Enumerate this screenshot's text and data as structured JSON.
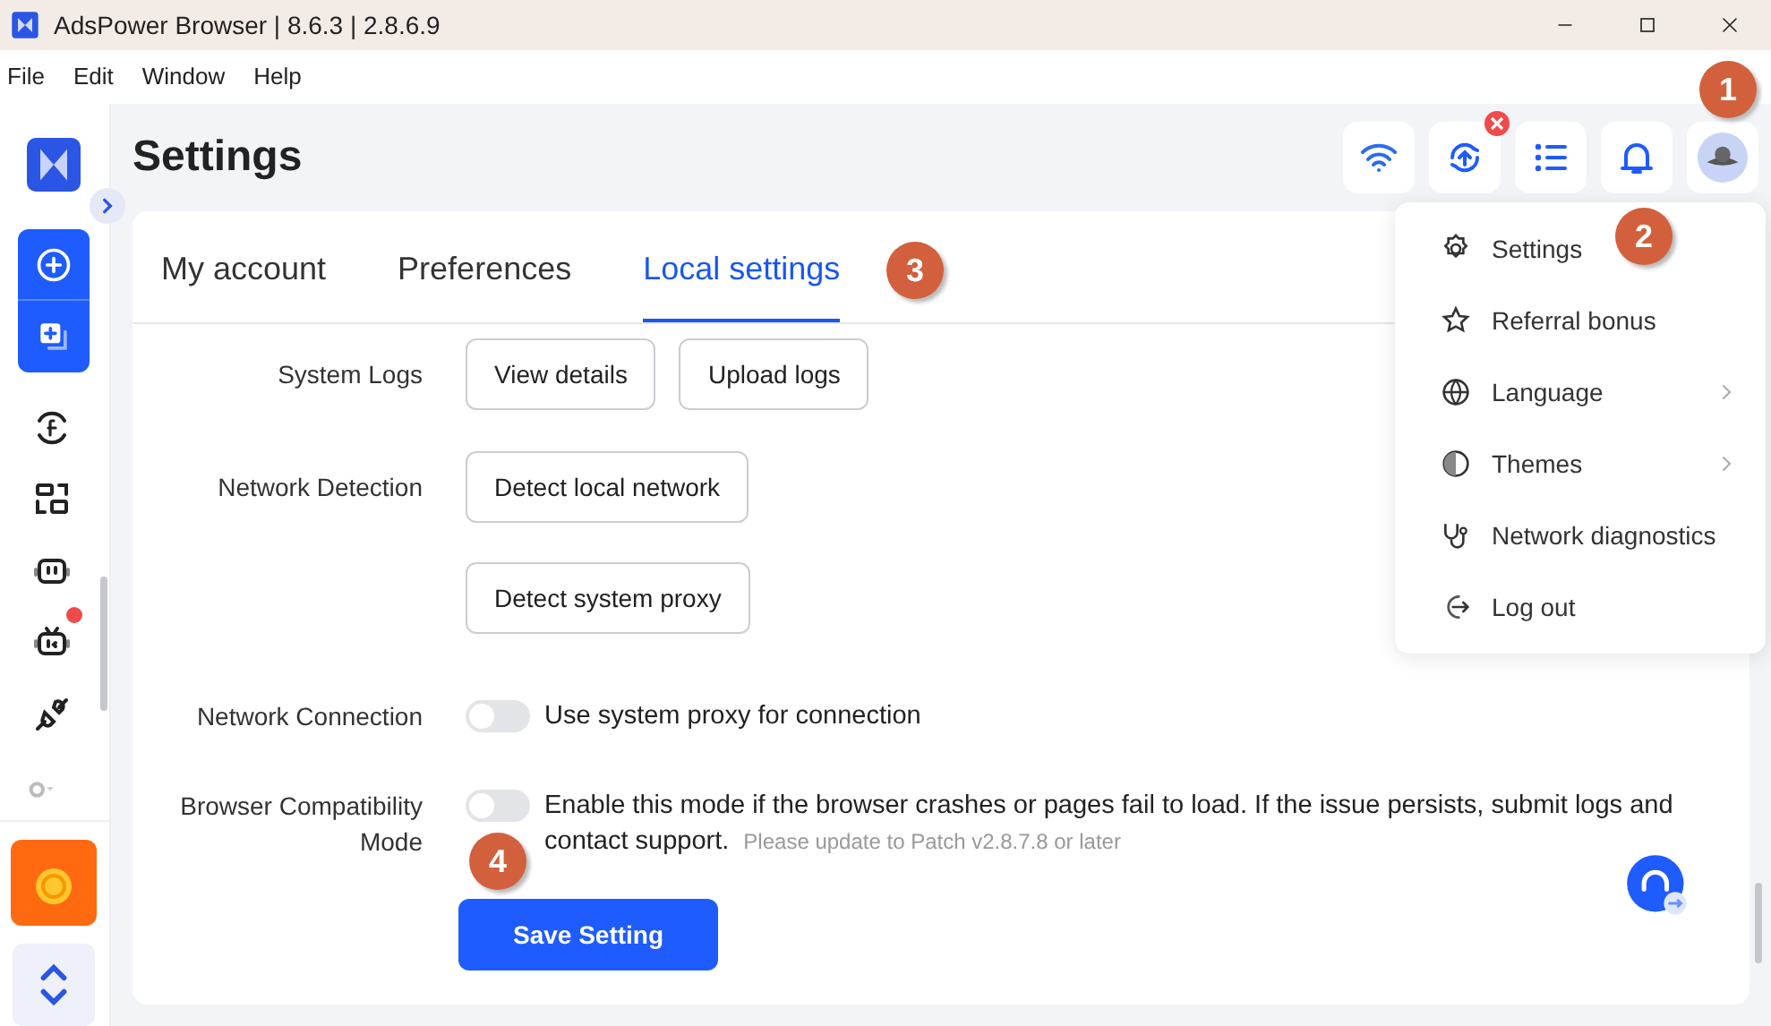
{
  "window": {
    "title": "AdsPower Browser | 8.6.3 | 2.8.6.9"
  },
  "menu_bar": [
    "File",
    "Edit",
    "Window",
    "Help"
  ],
  "sidebar": {
    "items": [
      {
        "kind": "facebook-sync",
        "alert": false
      },
      {
        "kind": "layout",
        "alert": false
      },
      {
        "kind": "robot",
        "alert": false
      },
      {
        "kind": "robot2",
        "alert": true
      },
      {
        "kind": "plug",
        "alert": false
      }
    ]
  },
  "page_title": "Settings",
  "toolbar": {
    "update_error": true
  },
  "tabs": [
    {
      "label": "My account",
      "selected": false
    },
    {
      "label": "Preferences",
      "selected": false
    },
    {
      "label": "Local settings",
      "selected": true
    }
  ],
  "rows": [
    {
      "kind": "buttons",
      "label": "System Logs",
      "buttons": [
        "View details",
        "Upload logs"
      ]
    },
    {
      "kind": "stacked",
      "label": "Network Detection",
      "buttons": [
        "Detect local network",
        "Detect system proxy"
      ]
    },
    {
      "kind": "toggle",
      "label": "Network Connection",
      "on": false,
      "text": "Use system proxy for connection"
    },
    {
      "kind": "toggle",
      "label": "Browser Compatibility Mode",
      "on": false,
      "text": "Enable this mode if the browser crashes or pages fail to load. If the issue persists, submit logs and contact support.",
      "note": "Please update to Patch v2.8.7.8 or later"
    }
  ],
  "save_button": "Save Setting",
  "dropdown": {
    "items": [
      {
        "kind": "gear",
        "label": "Settings",
        "submenu": false
      },
      {
        "kind": "star",
        "label": "Referral bonus",
        "submenu": false
      },
      {
        "kind": "globe",
        "label": "Language",
        "submenu": true
      },
      {
        "kind": "contrast",
        "label": "Themes",
        "submenu": true
      },
      {
        "kind": "diag",
        "label": "Network diagnostics",
        "submenu": false
      },
      {
        "kind": "logout",
        "label": "Log out",
        "submenu": false
      }
    ]
  },
  "markers": [
    "1",
    "2",
    "3",
    "4"
  ]
}
